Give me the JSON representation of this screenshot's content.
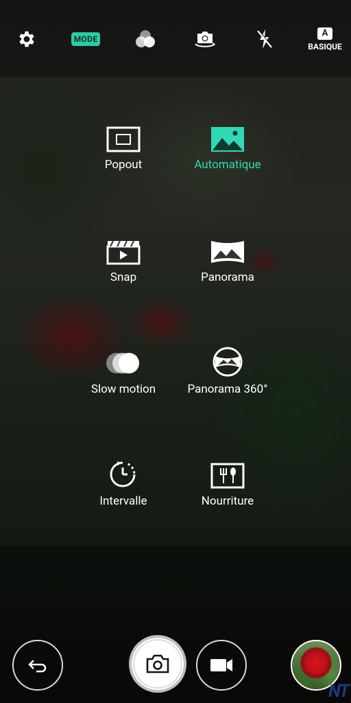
{
  "topbar": {
    "settings_icon": "gear-icon",
    "mode_label": "MODE",
    "filter_icon": "filter-circles-icon",
    "switch_camera_icon": "camera-switch-icon",
    "flash_icon": "flash-off-icon",
    "basic_mode_letter": "A",
    "basic_mode_label": "BASIQUE"
  },
  "modes": [
    {
      "label": "Popout",
      "icon": "popout-icon",
      "active": false
    },
    {
      "label": "Automatique",
      "icon": "auto-picture-icon",
      "active": true
    },
    {
      "label": "Snap",
      "icon": "snap-clapperboard-icon",
      "active": false
    },
    {
      "label": "Panorama",
      "icon": "panorama-icon",
      "active": false
    },
    {
      "label": "Slow motion",
      "icon": "slow-motion-icon",
      "active": false
    },
    {
      "label": "Panorama 360°",
      "icon": "panorama-360-icon",
      "active": false
    },
    {
      "label": "Intervalle",
      "icon": "interval-timer-icon",
      "active": false
    },
    {
      "label": "Nourriture",
      "icon": "food-icon",
      "active": false
    }
  ],
  "bottom": {
    "back_icon": "back-arrow-icon",
    "shutter_icon": "camera-icon",
    "video_icon": "video-camera-icon",
    "gallery_icon": "gallery-thumbnail"
  },
  "watermark": "NT",
  "colors": {
    "accent": "#34d7b4",
    "mode_badge": "#2fc9a6"
  }
}
